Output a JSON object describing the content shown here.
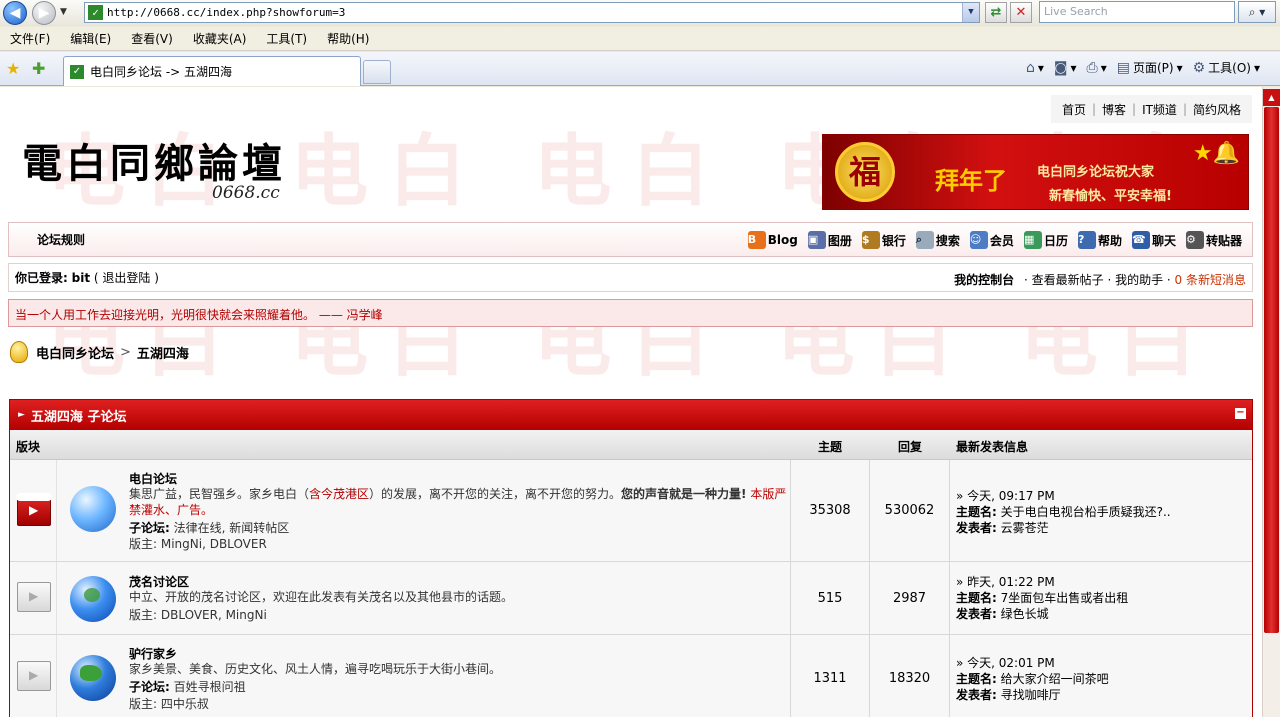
{
  "browser": {
    "url": "http://0668.cc/index.php?showforum=3",
    "search_placeholder": "Live Search",
    "menu": [
      "文件(F)",
      "编辑(E)",
      "查看(V)",
      "收藏夹(A)",
      "工具(T)",
      "帮助(H)"
    ],
    "tab_title": "电白同乡论坛 -> 五湖四海",
    "commands": {
      "page": "页面(P)",
      "tools": "工具(O)"
    }
  },
  "site": {
    "topnav": [
      "首页",
      "博客",
      "IT频道",
      "简约风格"
    ],
    "logo_cn": "電白同鄉論壇",
    "logo_en": "0668.cc",
    "banner": {
      "fu": "福",
      "big": "拜年了",
      "line1": "电白同乡论坛祝大家",
      "line2": "新春愉快、平安幸福!"
    },
    "rules_label": "论坛规则",
    "nav_links": [
      "Blog",
      "图册",
      "银行",
      "搜索",
      "会员",
      "日历",
      "帮助",
      "聊天",
      "转贴器"
    ],
    "login": {
      "prefix": "你已登录:",
      "user": "bit",
      "logout": "( 退出登陆 )",
      "control_panel": "我的控制台",
      "newest": "· 查看最新帖子",
      "assistant": "· 我的助手 ·",
      "messages": "0 条新短消息"
    },
    "quote": "当一个人用工作去迎接光明，光明很快就会来照耀着他。  ——  冯学峰",
    "breadcrumb": {
      "root": "电白同乡论坛",
      "sep": ">",
      "current": "五湖四海"
    }
  },
  "forum_block": {
    "title": "五湖四海  子论坛",
    "collapse": "−",
    "columns": {
      "board": "版块",
      "topics": "主题",
      "replies": "回复",
      "last": "最新发表信息"
    },
    "rows": [
      {
        "name": "电白论坛",
        "desc_a": "集思广益，民智强乡。家乡电白（",
        "desc_link": "含今茂港区",
        "desc_b": "）的发展，离不开您的关注，离不开您的努力。",
        "desc_strong": "您的声音就是一种力量!",
        "desc_red": " 本版严禁灌水、广告。",
        "sub_label": "子论坛:",
        "sub_value": " 法律在线, 新闻转帖区",
        "mods": "版主: MingNi, DBLOVER",
        "topics": "35308",
        "replies": "530062",
        "last_time": "» 今天, 09:17 PM",
        "last_subject_label": "主题名:",
        "last_subject": " 关于电白电视台柗手质疑我还?..",
        "last_author_label": "发表者:",
        "last_author": " 云雾苍茫"
      },
      {
        "name": "茂名讨论区",
        "desc_a": "中立、开放的茂名讨论区，欢迎在此发表有关茂名以及其他县市的话题。",
        "mods": "版主: DBLOVER, MingNi",
        "topics": "515",
        "replies": "2987",
        "last_time": "» 昨天, 01:22 PM",
        "last_subject_label": "主题名:",
        "last_subject": " 7坐面包车出售或者出租",
        "last_author_label": "发表者:",
        "last_author": " 绿色长城"
      },
      {
        "name": "驴行家乡",
        "desc_a": "家乡美景、美食、历史文化、风土人情，遍寻吃喝玩乐于大街小巷间。",
        "sub_label": "子论坛:",
        "sub_value": " 百姓寻根问祖",
        "mods": "版主: 四中乐叔",
        "topics": "1311",
        "replies": "18320",
        "last_time": "» 今天, 02:01 PM",
        "last_subject_label": "主题名:",
        "last_subject": " 给大家介绍一间茶吧",
        "last_author_label": "发表者:",
        "last_author": " 寻找咖啡厅"
      }
    ]
  }
}
